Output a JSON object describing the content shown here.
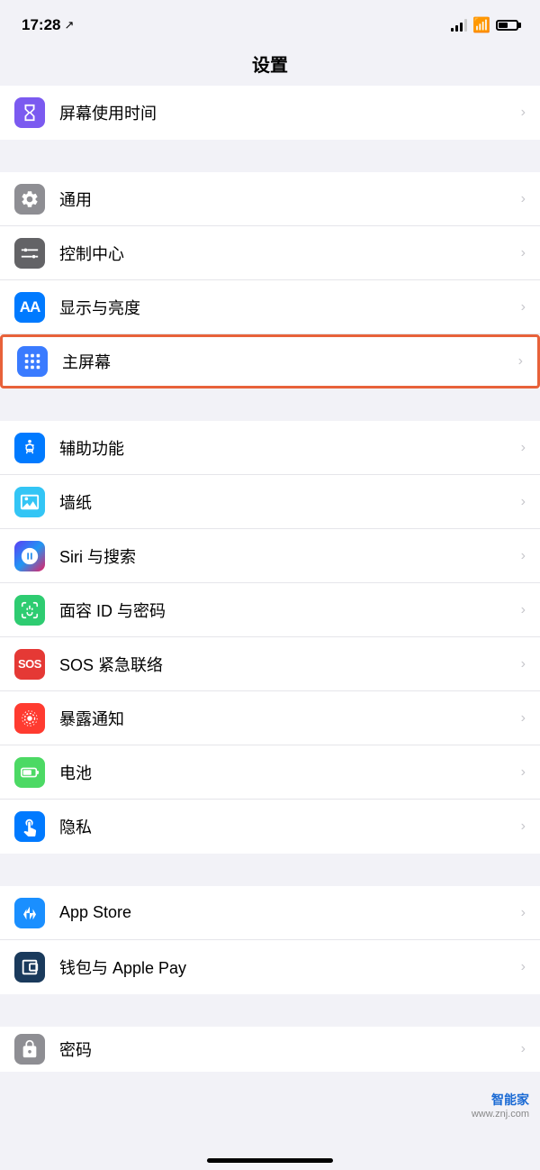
{
  "statusBar": {
    "time": "17:28",
    "arrowIcon": "↗"
  },
  "pageTitle": "设置",
  "groups": [
    {
      "id": "group-top",
      "items": [
        {
          "id": "screen-time",
          "icon": "screen-time",
          "iconBg": "icon-screen-time",
          "label": "屏幕使用时间",
          "partial": false
        }
      ]
    },
    {
      "id": "group-display",
      "items": [
        {
          "id": "general",
          "icon": "general",
          "iconBg": "icon-general",
          "label": "通用",
          "partial": false
        },
        {
          "id": "control-center",
          "icon": "control-center",
          "iconBg": "icon-control-center",
          "label": "控制中心",
          "partial": false
        },
        {
          "id": "display",
          "icon": "display",
          "iconBg": "icon-display",
          "label": "显示与亮度",
          "partial": false
        },
        {
          "id": "home-screen",
          "icon": "home-screen",
          "iconBg": "icon-home-screen",
          "label": "主屏幕",
          "highlighted": true,
          "partial": false
        }
      ]
    },
    {
      "id": "group-features",
      "items": [
        {
          "id": "accessibility",
          "icon": "accessibility",
          "iconBg": "icon-accessibility",
          "label": "辅助功能",
          "partial": false
        },
        {
          "id": "wallpaper",
          "icon": "wallpaper",
          "iconBg": "icon-wallpaper",
          "label": "墙纸",
          "partial": false
        },
        {
          "id": "siri",
          "icon": "siri",
          "iconBg": "icon-siri",
          "label": "Siri 与搜索",
          "partial": false
        },
        {
          "id": "face-id",
          "icon": "face-id",
          "iconBg": "icon-face-id",
          "label": "面容 ID 与密码",
          "partial": false
        },
        {
          "id": "sos",
          "icon": "sos",
          "iconBg": "icon-sos",
          "label": "SOS 紧急联络",
          "partial": false
        },
        {
          "id": "exposure",
          "icon": "exposure",
          "iconBg": "icon-exposure",
          "label": "暴露通知",
          "partial": false
        },
        {
          "id": "battery",
          "icon": "battery",
          "iconBg": "icon-battery",
          "label": "电池",
          "partial": false
        },
        {
          "id": "privacy",
          "icon": "privacy",
          "iconBg": "icon-privacy",
          "label": "隐私",
          "partial": false
        }
      ]
    },
    {
      "id": "group-store",
      "items": [
        {
          "id": "appstore",
          "icon": "appstore",
          "iconBg": "icon-appstore",
          "label": "App Store",
          "partial": false
        },
        {
          "id": "wallet",
          "icon": "wallet",
          "iconBg": "icon-wallet",
          "label": "钱包与 Apple Pay",
          "partial": false
        }
      ]
    },
    {
      "id": "group-password",
      "items": [
        {
          "id": "password",
          "icon": "password",
          "iconBg": "icon-password",
          "label": "密码",
          "partial": true
        }
      ]
    }
  ],
  "watermark": {
    "title": "智能家",
    "url": "www.znj.com"
  },
  "chevron": "›"
}
